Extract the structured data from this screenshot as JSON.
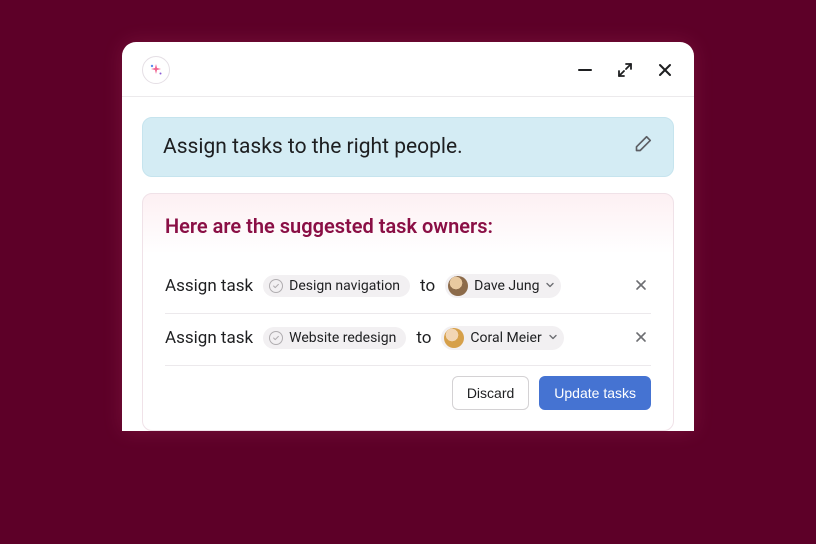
{
  "query": {
    "text": "Assign tasks to the right people."
  },
  "card": {
    "title": "Here are the suggested task owners:",
    "rows": [
      {
        "prefix": "Assign task",
        "task": "Design navigation",
        "to_label": "to",
        "person": "Dave Jung"
      },
      {
        "prefix": "Assign task",
        "task": "Website redesign",
        "to_label": "to",
        "person": "Coral Meier"
      }
    ]
  },
  "footer": {
    "discard": "Discard",
    "submit": "Update tasks"
  }
}
